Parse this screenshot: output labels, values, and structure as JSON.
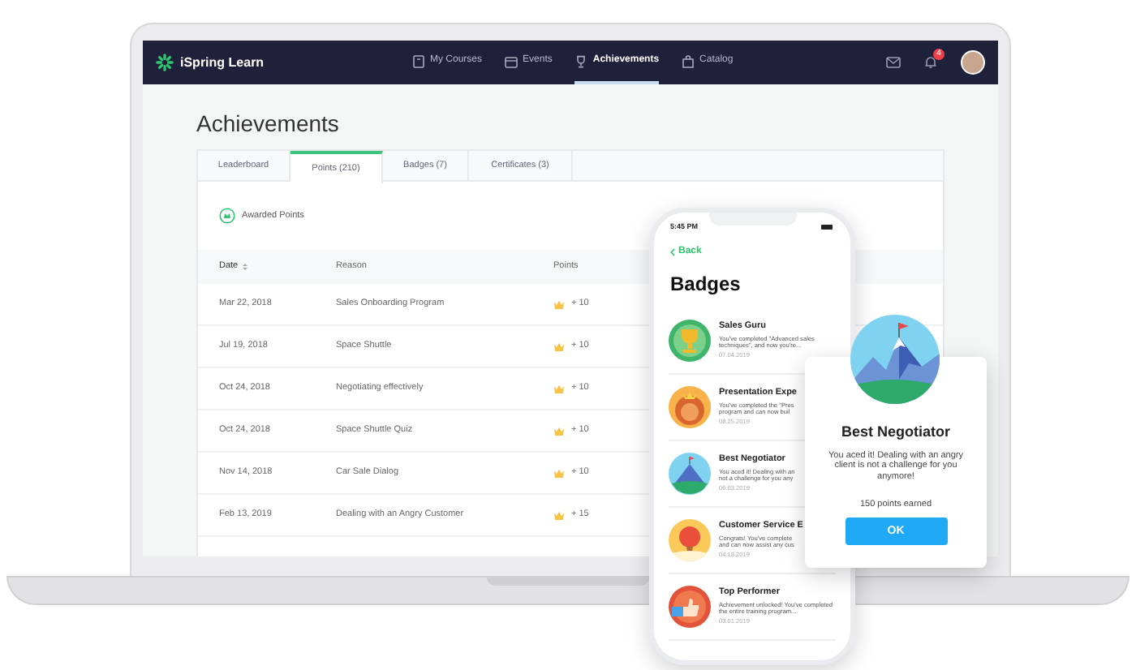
{
  "navbar": {
    "brand": "iSpring Learn",
    "items": [
      {
        "label": "My Courses",
        "selected": false
      },
      {
        "label": "Events",
        "selected": false
      },
      {
        "label": "Achievements",
        "selected": true
      },
      {
        "label": "Catalog",
        "selected": false
      }
    ],
    "notification_count": "4"
  },
  "page": {
    "title": "Achievements",
    "tabs": [
      {
        "label": "Leaderboard",
        "selected": false
      },
      {
        "label": "Points (210)",
        "selected": true
      },
      {
        "label": "Badges (7)",
        "selected": false
      },
      {
        "label": "Certificates (3)",
        "selected": false
      }
    ],
    "section_label": "Awarded Points",
    "table": {
      "columns": [
        "Date",
        "Reason",
        "Points"
      ],
      "rows": [
        {
          "date": "Mar 22, 2018",
          "reason": "Sales Onboarding Program",
          "points": "+ 10"
        },
        {
          "date": "Jul 19, 2018",
          "reason": "Space Shuttle",
          "points": "+ 10"
        },
        {
          "date": "Oct 24, 2018",
          "reason": "Negotiating effectively",
          "points": "+ 10"
        },
        {
          "date": "Oct 24, 2018",
          "reason": "Space Shuttle Quiz",
          "points": "+ 10"
        },
        {
          "date": "Nov 14, 2018",
          "reason": "Car Sale Dialog",
          "points": "+ 10"
        },
        {
          "date": "Feb 13, 2019",
          "reason": "Dealing with an Angry Customer",
          "points": "+ 15"
        }
      ]
    }
  },
  "phone": {
    "time": "5:45 PM",
    "back": "Back",
    "title": "Badges",
    "badges": [
      {
        "title": "Sales Guru",
        "description": "You've completed \"Advanced sales techniques\", and now you're...",
        "date": "07.04.2019"
      },
      {
        "title": "Presentation Expe",
        "description": "You've completed the \"Pres program and can now buil",
        "date": "08.25.2019"
      },
      {
        "title": "Best Negotiator",
        "description": "You aced it! Dealing with an not a challenge for you any",
        "date": "06.03.2019"
      },
      {
        "title": "Customer Service E",
        "description": "Congrats! You've complete and can now assist any cus",
        "date": "04.18.2019"
      },
      {
        "title": "Top Performer",
        "description": "Achievement unlocked! You've completed the entire training program...",
        "date": "03.01.2019"
      }
    ]
  },
  "popup": {
    "title": "Best Negotiator",
    "message": "You aced it! Dealing with an angry client is not a challenge for you anymore!",
    "points": "150 points earned",
    "button": "OK"
  }
}
